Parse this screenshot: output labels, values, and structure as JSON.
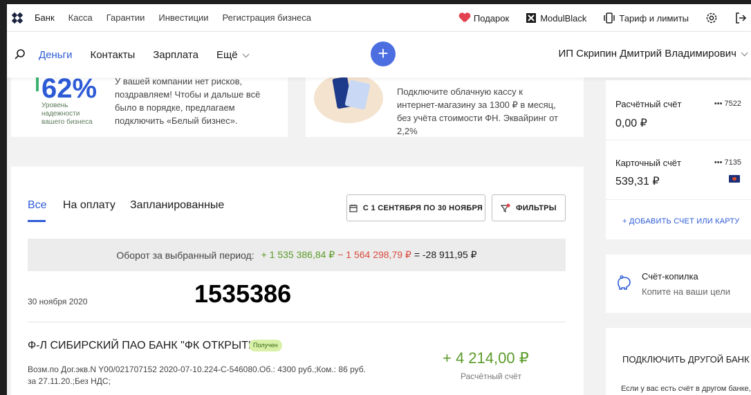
{
  "topbar": {
    "links": [
      "Банк",
      "Касса",
      "Гарантии",
      "Инвестиции",
      "Регистрация бизнеса"
    ],
    "gift": "Подарок",
    "modul": "ModulBlack",
    "tariff": "Тариф и лимиты"
  },
  "nav": {
    "links": [
      "Деньги",
      "Контакты",
      "Зарплата",
      "Ещё"
    ],
    "user": "ИП Скрипин Дмитрий Владимирович"
  },
  "card1": {
    "percent": "62%",
    "reliability": "Уровень надежности вашего бизнеса",
    "text": "У вашей компании нет рисков, поздравляем! Чтобы и дальше всё было в порядке, предлагаем подключить «Белый бизнес»."
  },
  "card2": {
    "text": "Подключите облачную кассу к интернет-магазину за 1300 ₽ в месяц, без учёта стоимости ФН. Эквайринг от 2,2%"
  },
  "accounts": [
    {
      "label": "Расчётный счёт",
      "number": "••• 7522",
      "amount": "0,00 ₽"
    },
    {
      "label": "Карточный счёт",
      "number": "••• 7135",
      "amount": "539,31 ₽"
    }
  ],
  "add_account": "+ ДОБАВИТЬ СЧЕТ ИЛИ КАРТУ",
  "piggy": {
    "title": "Счёт-копилка",
    "subtitle": "Копите на ваши цели"
  },
  "other_bank": {
    "title": "ПОДКЛЮЧИТЬ ДРУГОЙ БАНК",
    "desc": "Если у вас есть счёт в другом банке,"
  },
  "tabs": [
    "Все",
    "На оплату",
    "Запланированные"
  ],
  "date_range": "С 1 СЕНТЯБРЯ ПО 30 НОЯБРЯ",
  "filters": "ФИЛЬТРЫ",
  "turnover": {
    "label": "Оборот за выбранный период:",
    "income": "+ 1 535 386,84 ₽",
    "expense": "− 1 564 298,79 ₽",
    "total": "= -28 911,95 ₽"
  },
  "date": "30 ноября 2020",
  "overlay_number": "1535386",
  "transaction": {
    "title": "Ф-Л СИБИРСКИЙ ПАО БАНК \"ФК ОТКРЫТИЕ\"",
    "status": "Получен",
    "desc": "Возм.по Дог.экв.N Y00/021707152 2020-07-10.224-C-546080.Об.: 4300 руб.;Ком.: 86 руб. за 27.11.20.;Без НДС;",
    "amount": "+ 4 214,00 ₽",
    "account": "Расчётный счёт"
  },
  "colors": {
    "accent": "#2d5bd6",
    "income": "#5b9b2a",
    "expense": "#d94b3f"
  }
}
